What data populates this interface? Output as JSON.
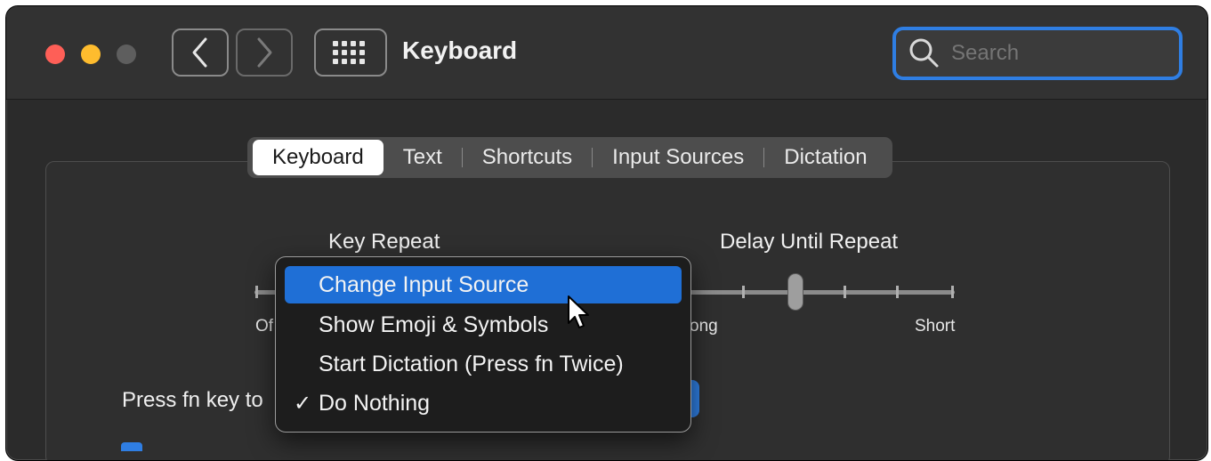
{
  "window": {
    "title": "Keyboard"
  },
  "toolbar": {
    "search_placeholder": "Search"
  },
  "tabs": [
    {
      "label": "Keyboard",
      "active": true
    },
    {
      "label": "Text",
      "active": false
    },
    {
      "label": "Shortcuts",
      "active": false
    },
    {
      "label": "Input Sources",
      "active": false
    },
    {
      "label": "Dictation",
      "active": false
    }
  ],
  "key_repeat": {
    "label": "Key Repeat",
    "min_label_partial": "Of"
  },
  "delay_until_repeat": {
    "label": "Delay Until Repeat",
    "min_label_partial": "ong",
    "max_label": "Short"
  },
  "fn_key": {
    "label_partial": "Press fn key to"
  },
  "menu": {
    "items": [
      {
        "label": "Change Input Source",
        "highlighted": true,
        "checked": false
      },
      {
        "label": "Show Emoji & Symbols",
        "highlighted": false,
        "checked": false
      },
      {
        "label": "Start Dictation (Press fn Twice)",
        "highlighted": false,
        "checked": false
      },
      {
        "label": "Do Nothing",
        "highlighted": false,
        "checked": true
      }
    ],
    "check_glyph": "✓"
  },
  "colors": {
    "accent": "#2f7ee3",
    "menu_highlight": "#1f6fd6"
  }
}
